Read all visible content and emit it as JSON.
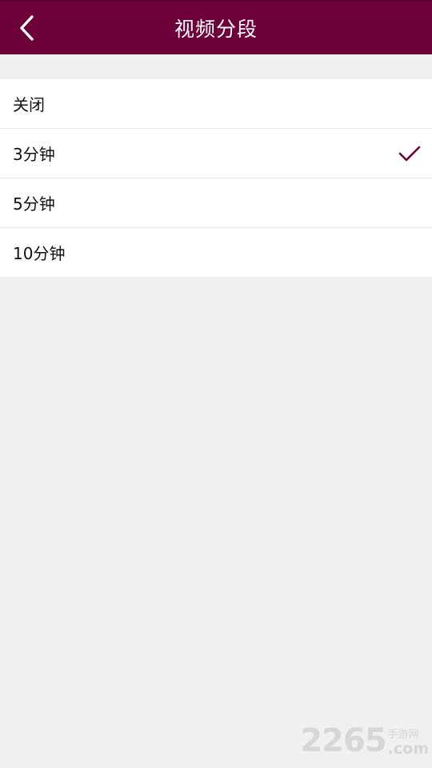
{
  "header": {
    "title": "视频分段",
    "back_icon": "chevron-left-icon"
  },
  "options": [
    {
      "label": "关闭",
      "selected": false
    },
    {
      "label": "3分钟",
      "selected": true
    },
    {
      "label": "5分钟",
      "selected": false
    },
    {
      "label": "10分钟",
      "selected": false
    }
  ],
  "check_icon": "checkmark-icon",
  "watermark": {
    "number": "2265",
    "chinese": "手游网",
    "domain": ".com"
  },
  "colors": {
    "accent": "#6d0039",
    "background": "#f0f0f0",
    "row_background": "#ffffff"
  }
}
